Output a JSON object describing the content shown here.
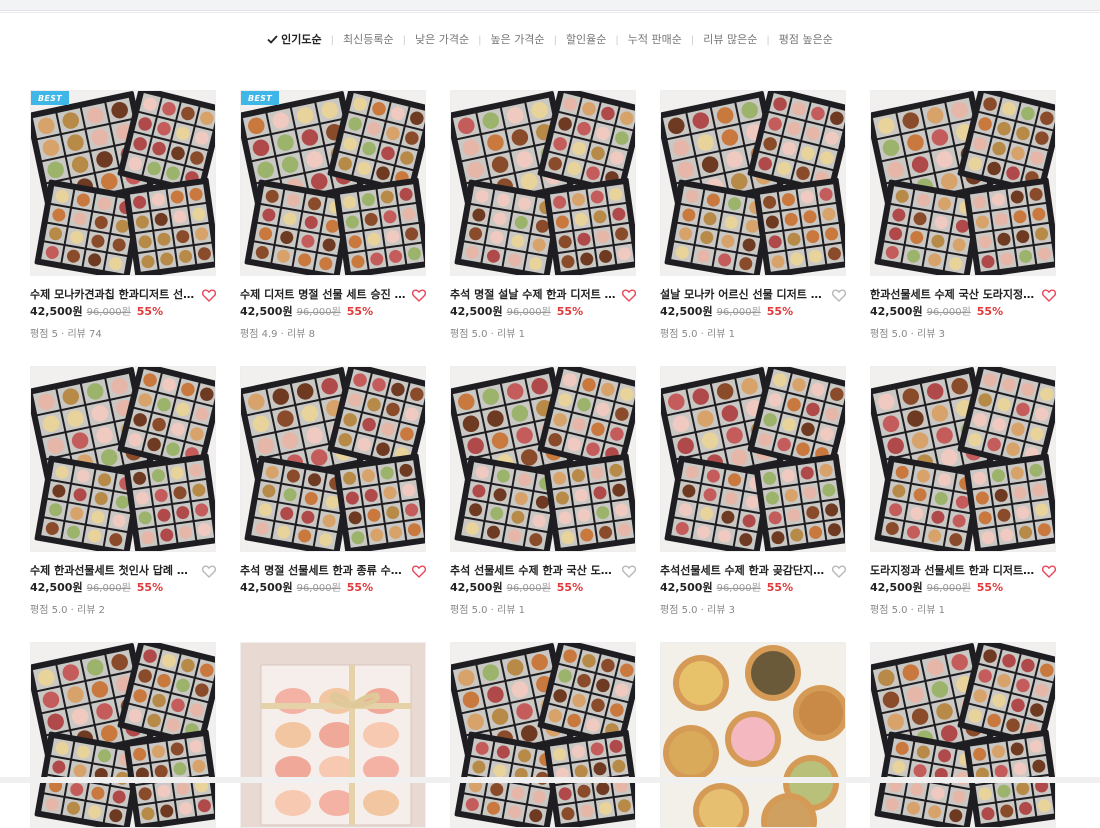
{
  "sort": {
    "options": [
      {
        "label": "인기도순",
        "active": true
      },
      {
        "label": "최신등록순",
        "active": false
      },
      {
        "label": "낮은 가격순",
        "active": false
      },
      {
        "label": "높은 가격순",
        "active": false
      },
      {
        "label": "할인율순",
        "active": false
      },
      {
        "label": "누적 판매순",
        "active": false
      },
      {
        "label": "리뷰 많은순",
        "active": false
      },
      {
        "label": "평점 높은순",
        "active": false
      }
    ]
  },
  "colors": {
    "badge": "#3fb6e8",
    "discount": "#e03a3a",
    "heart_active": "#e8475a",
    "heart_inactive": "#b8b8b8"
  },
  "products": [
    {
      "title": "수제 모나카견과칩 한과디저트 선물 세트",
      "price": "42,500원",
      "original": "96,000원",
      "discount": "55%",
      "meta": "평점 5 · 리뷰 74",
      "badge": "BEST",
      "liked": true,
      "photo": "box-grid"
    },
    {
      "title": "수제 디저트 명절 선물 세트 승진 인사",
      "price": "42,500원",
      "original": "96,000원",
      "discount": "55%",
      "meta": "평점 4.9 · 리뷰 8",
      "badge": "BEST",
      "liked": true,
      "photo": "box-grid"
    },
    {
      "title": "추석 명절 설날 수제 한과 디저트 선물",
      "price": "42,500원",
      "original": "96,000원",
      "discount": "55%",
      "meta": "평점 5.0 · 리뷰 1",
      "badge": "",
      "liked": true,
      "photo": "box-grid"
    },
    {
      "title": "설날 모나카 어르신 선물 디저트 한과 세트",
      "price": "42,500원",
      "original": "96,000원",
      "discount": "55%",
      "meta": "평점 5.0 · 리뷰 1",
      "badge": "",
      "liked": false,
      "photo": "box-grid"
    },
    {
      "title": "한과선물세트 수제 국산 도라지정과 세트",
      "price": "42,500원",
      "original": "96,000원",
      "discount": "55%",
      "meta": "평점 5.0 · 리뷰 3",
      "badge": "",
      "liked": true,
      "photo": "box-grid"
    },
    {
      "title": "수제 한과선물세트 첫인사 답례 여자친구",
      "price": "42,500원",
      "original": "96,000원",
      "discount": "55%",
      "meta": "평점 5.0 · 리뷰 2",
      "badge": "",
      "liked": false,
      "photo": "box-grid"
    },
    {
      "title": "추석 명절 선물세트 한과 종류 수제 디저트",
      "price": "42,500원",
      "original": "96,000원",
      "discount": "55%",
      "meta": "",
      "badge": "",
      "liked": true,
      "photo": "box-grid"
    },
    {
      "title": "추석 선물세트 수제 한과 국산 도라지정과",
      "price": "42,500원",
      "original": "96,000원",
      "discount": "55%",
      "meta": "평점 5.0 · 리뷰 1",
      "badge": "",
      "liked": false,
      "photo": "box-grid"
    },
    {
      "title": "추석선물세트 수제 한과 곶감단지 도라지",
      "price": "42,500원",
      "original": "96,000원",
      "discount": "55%",
      "meta": "평점 5.0 · 리뷰 3",
      "badge": "",
      "liked": false,
      "photo": "box-grid"
    },
    {
      "title": "도라지정과 선물세트 한과 디저트 전통",
      "price": "42,500원",
      "original": "96,000원",
      "discount": "55%",
      "meta": "평점 5.0 · 리뷰 1",
      "badge": "",
      "liked": true,
      "photo": "box-grid"
    },
    {
      "title": "",
      "price": "",
      "original": "",
      "discount": "",
      "meta": "",
      "badge": "",
      "liked": false,
      "photo": "box-grid"
    },
    {
      "title": "",
      "price": "",
      "original": "",
      "discount": "",
      "meta": "",
      "badge": "",
      "liked": false,
      "photo": "ribbon-box"
    },
    {
      "title": "",
      "price": "",
      "original": "",
      "discount": "",
      "meta": "",
      "badge": "",
      "liked": false,
      "photo": "box-grid"
    },
    {
      "title": "",
      "price": "",
      "original": "",
      "discount": "",
      "meta": "",
      "badge": "",
      "liked": false,
      "photo": "tart-plate"
    },
    {
      "title": "",
      "price": "",
      "original": "",
      "discount": "",
      "meta": "",
      "badge": "",
      "liked": false,
      "photo": "box-grid"
    }
  ]
}
